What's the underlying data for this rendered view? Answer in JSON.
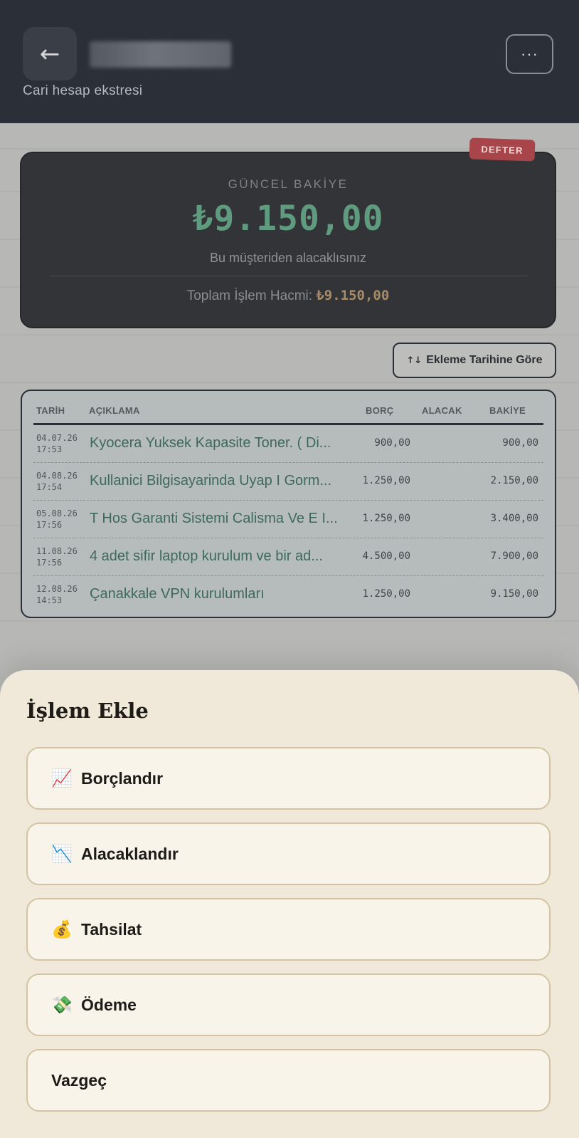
{
  "header": {
    "back_icon": "arrow-left-icon",
    "back_glyph": "←",
    "subtitle": "Cari hesap ekstresi",
    "more_glyph": "···"
  },
  "balance": {
    "badge": "DEFTER",
    "label": "GÜNCEL BAKİYE",
    "amount": "₺9.150,00",
    "description": "Bu müşteriden alacaklısınız",
    "volume_label": "Toplam İşlem Hacmi: ",
    "volume_value": "₺9.150,00",
    "amount_color": "#5f9c7f",
    "badge_color": "#a8454a"
  },
  "sort": {
    "icon": "↑↓",
    "label": "Ekleme Tarihine Göre"
  },
  "table": {
    "headers": {
      "date": "TARİH",
      "desc": "AÇIKLAMA",
      "borc": "BORÇ",
      "alacak": "ALACAK",
      "bakiye": "BAKİYE"
    },
    "rows": [
      {
        "date": "04.07.26",
        "time": "17:53",
        "desc": "Kyocera Yuksek Kapasite Toner. ( Di...",
        "borc": "900,00",
        "alacak": "",
        "bakiye": "900,00"
      },
      {
        "date": "04.08.26",
        "time": "17:54",
        "desc": "Kullanici Bilgisayarinda Uyap I Gorm...",
        "borc": "1.250,00",
        "alacak": "",
        "bakiye": "2.150,00"
      },
      {
        "date": "05.08.26",
        "time": "17:56",
        "desc": "T Hos Garanti Sistemi Calisma Ve E I...",
        "borc": "1.250,00",
        "alacak": "",
        "bakiye": "3.400,00"
      },
      {
        "date": "11.08.26",
        "time": "17:56",
        "desc": "4 adet sifir laptop kurulum ve bir ad...",
        "borc": "4.500,00",
        "alacak": "",
        "bakiye": "7.900,00"
      },
      {
        "date": "12.08.26",
        "time": "14:53",
        "desc": "Çanakkale VPN kurulumları",
        "borc": "1.250,00",
        "alacak": "",
        "bakiye": "9.150,00"
      }
    ]
  },
  "sheet": {
    "title": "İşlem Ekle",
    "actions": [
      {
        "emoji": "📈",
        "icon": "chart-increasing-icon",
        "label": "Borçlandır"
      },
      {
        "emoji": "📉",
        "icon": "chart-decreasing-icon",
        "label": "Alacaklandır"
      },
      {
        "emoji": "💰",
        "icon": "money-bag-icon",
        "label": "Tahsilat"
      },
      {
        "emoji": "💸",
        "icon": "money-wings-icon",
        "label": "Ödeme"
      },
      {
        "emoji": "",
        "icon": "",
        "label": "Vazgeç"
      }
    ]
  }
}
